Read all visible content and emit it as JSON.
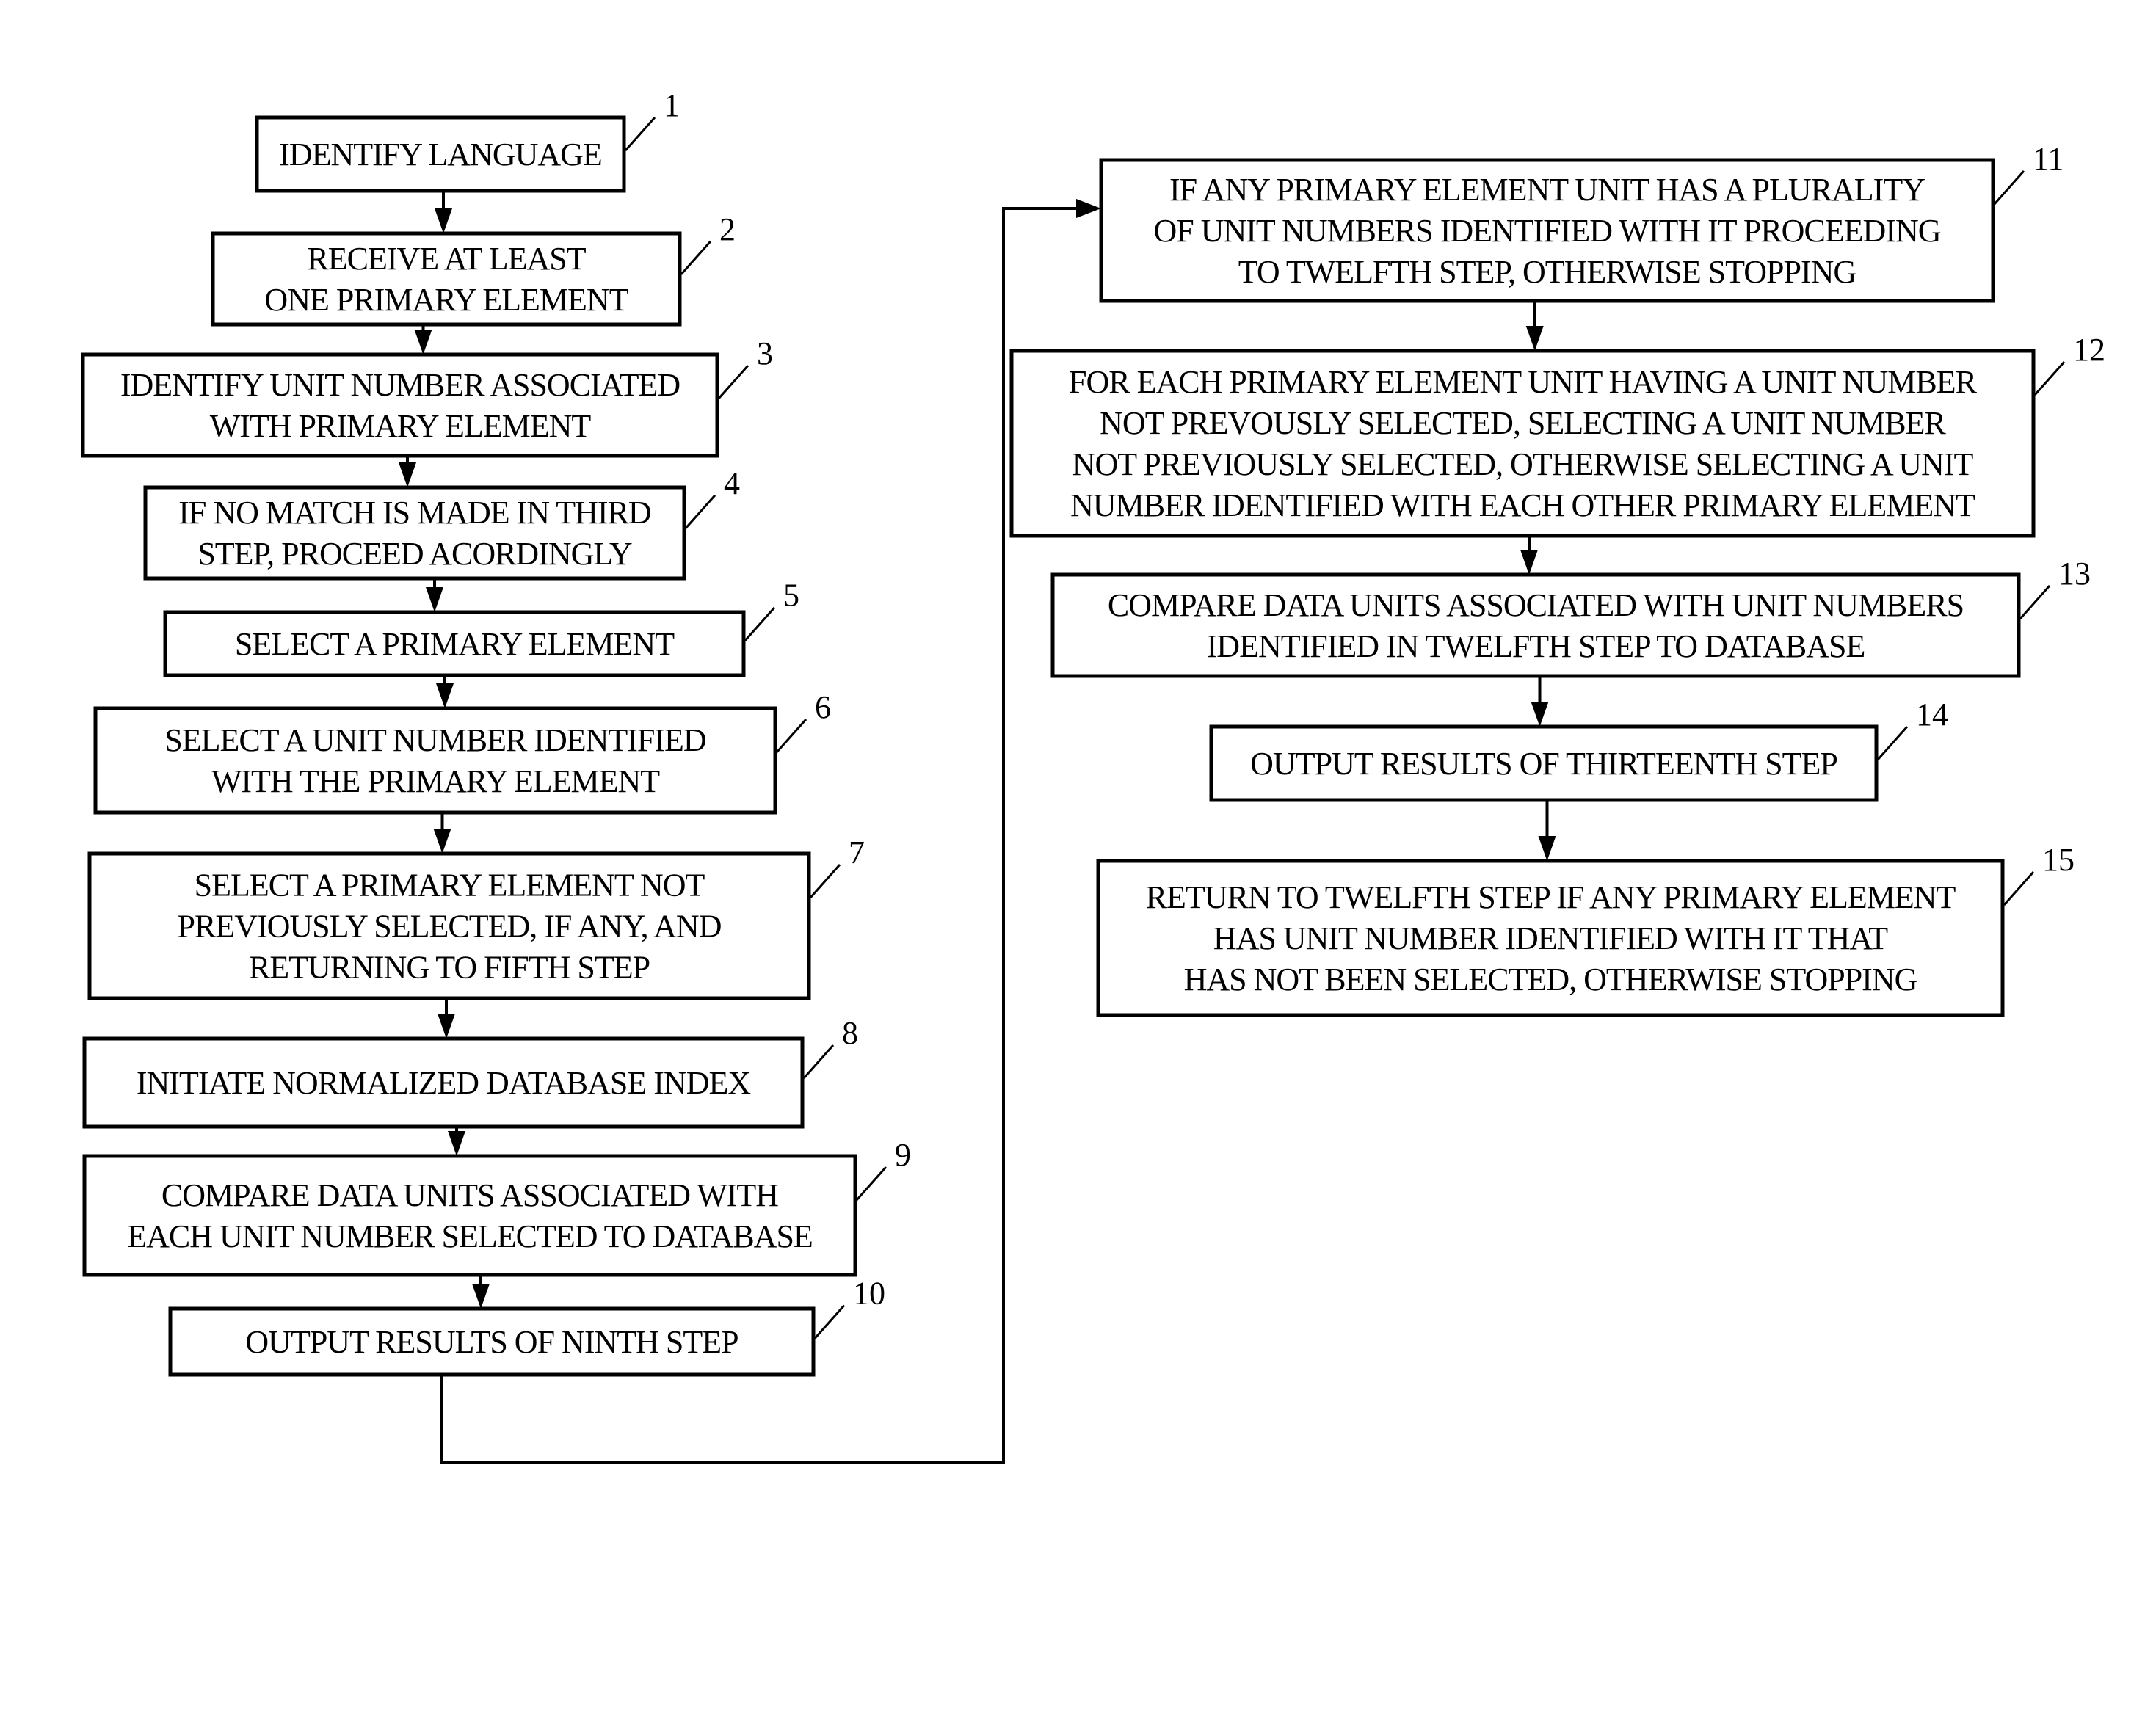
{
  "diagram": {
    "type": "flowchart",
    "steps": [
      {
        "id": "1",
        "lines": [
          "IDENTIFY LANGUAGE"
        ]
      },
      {
        "id": "2",
        "lines": [
          "RECEIVE AT LEAST",
          "ONE PRIMARY ELEMENT"
        ]
      },
      {
        "id": "3",
        "lines": [
          "IDENTIFY UNIT NUMBER ASSOCIATED",
          "WITH PRIMARY ELEMENT"
        ]
      },
      {
        "id": "4",
        "lines": [
          "IF NO MATCH IS MADE IN THIRD",
          "STEP, PROCEED ACORDINGLY"
        ]
      },
      {
        "id": "5",
        "lines": [
          "SELECT A PRIMARY ELEMENT"
        ]
      },
      {
        "id": "6",
        "lines": [
          "SELECT A UNIT NUMBER IDENTIFIED",
          "WITH THE PRIMARY ELEMENT"
        ]
      },
      {
        "id": "7",
        "lines": [
          "SELECT A PRIMARY ELEMENT NOT",
          "PREVIOUSLY SELECTED, IF ANY, AND",
          "RETURNING TO FIFTH STEP"
        ]
      },
      {
        "id": "8",
        "lines": [
          "INITIATE NORMALIZED DATABASE INDEX"
        ]
      },
      {
        "id": "9",
        "lines": [
          "COMPARE DATA UNITS ASSOCIATED WITH",
          "EACH UNIT NUMBER SELECTED TO DATABASE"
        ]
      },
      {
        "id": "10",
        "lines": [
          "OUTPUT RESULTS OF NINTH STEP"
        ]
      },
      {
        "id": "11",
        "lines": [
          "IF ANY PRIMARY ELEMENT UNIT HAS A PLURALITY",
          "OF UNIT NUMBERS IDENTIFIED WITH IT  PROCEEDING",
          "TO TWELFTH STEP, OTHERWISE STOPPING"
        ]
      },
      {
        "id": "12",
        "lines": [
          "FOR EACH PRIMARY ELEMENT UNIT HAVING A UNIT NUMBER",
          "NOT PREVOUSLY SELECTED, SELECTING A UNIT NUMBER",
          "NOT PREVIOUSLY SELECTED, OTHERWISE SELECTING A UNIT",
          "NUMBER IDENTIFIED WITH EACH OTHER PRIMARY ELEMENT"
        ]
      },
      {
        "id": "13",
        "lines": [
          "COMPARE DATA UNITS ASSOCIATED WITH UNIT NUMBERS",
          "IDENTIFIED IN TWELFTH STEP TO DATABASE"
        ]
      },
      {
        "id": "14",
        "lines": [
          "OUTPUT RESULTS OF THIRTEENTH STEP"
        ]
      },
      {
        "id": "15",
        "lines": [
          "RETURN TO TWELFTH STEP IF ANY PRIMARY ELEMENT",
          "HAS UNIT NUMBER IDENTIFIED WITH IT THAT",
          "HAS NOT BEEN SELECTED, OTHERWISE STOPPING"
        ]
      }
    ],
    "edges": [
      [
        "1",
        "2"
      ],
      [
        "2",
        "3"
      ],
      [
        "3",
        "4"
      ],
      [
        "4",
        "5"
      ],
      [
        "5",
        "6"
      ],
      [
        "6",
        "7"
      ],
      [
        "7",
        "8"
      ],
      [
        "8",
        "9"
      ],
      [
        "9",
        "10"
      ],
      [
        "10",
        "11"
      ],
      [
        "11",
        "12"
      ],
      [
        "12",
        "13"
      ],
      [
        "13",
        "14"
      ],
      [
        "14",
        "15"
      ]
    ]
  }
}
